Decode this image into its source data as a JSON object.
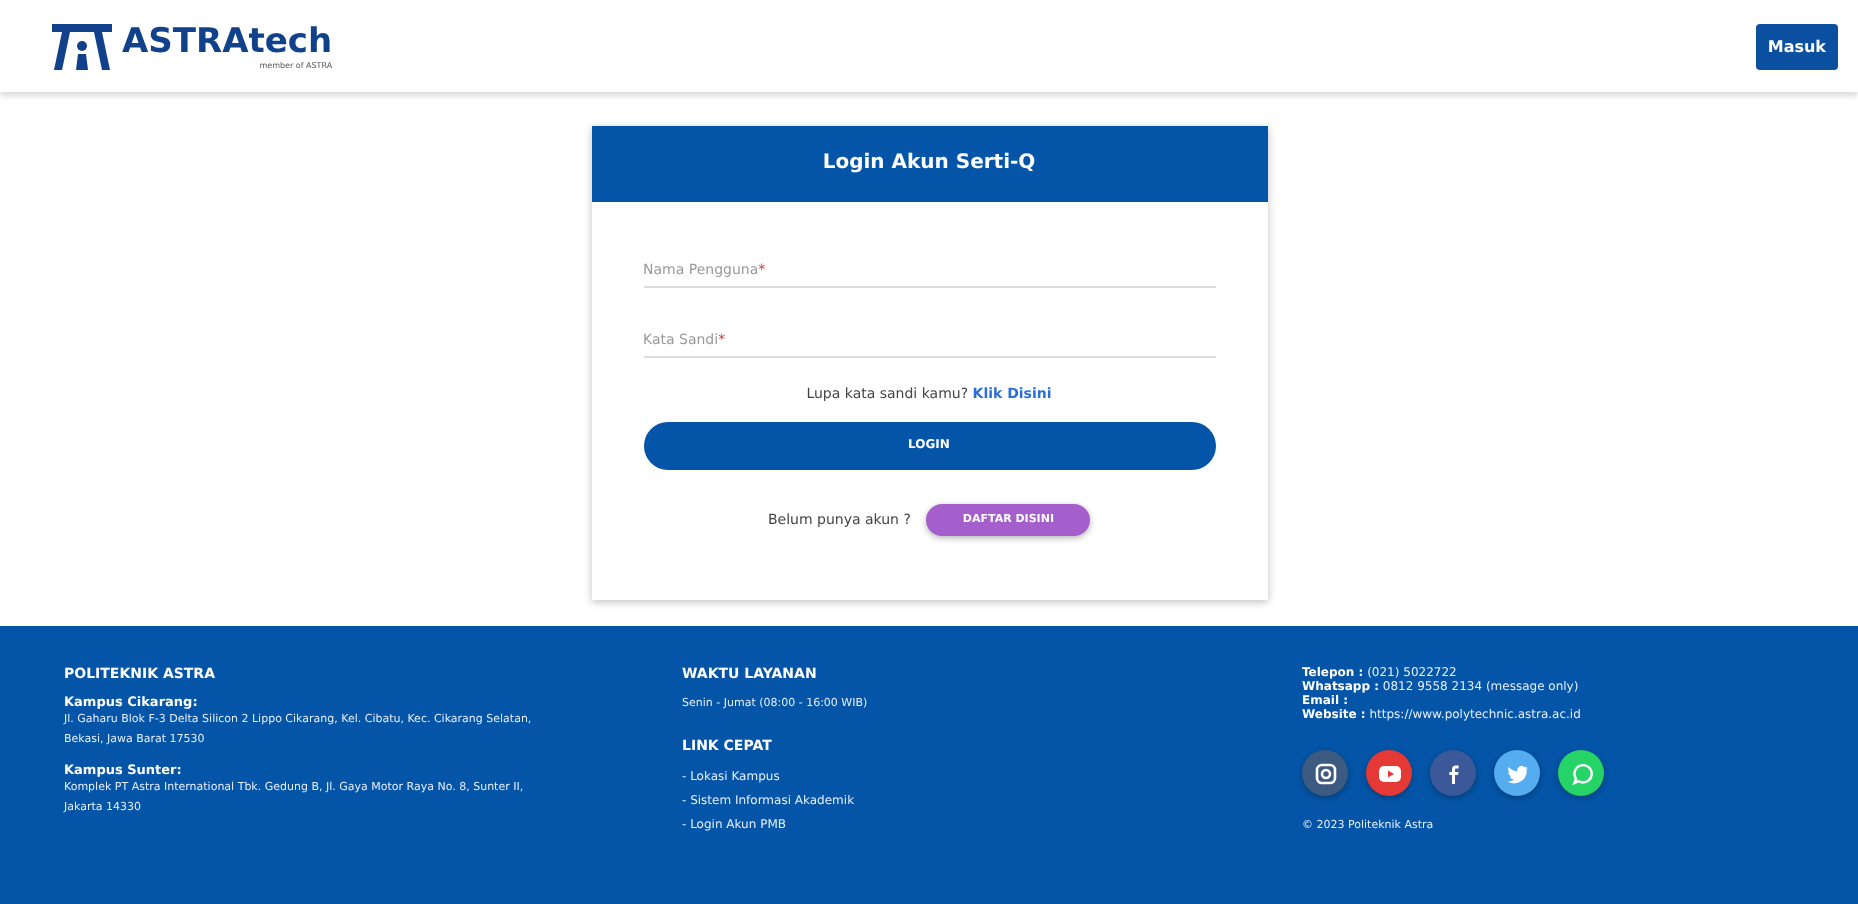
{
  "header": {
    "logo_text": "ASTRAtech",
    "logo_subtext": "member of ASTRA",
    "login_button": "Masuk"
  },
  "login_card": {
    "title": "Login Akun Serti-Q",
    "fields": [
      {
        "placeholder": "Nama Pengguna",
        "required_mark": "*"
      },
      {
        "placeholder": "Kata Sandi",
        "required_mark": "*"
      }
    ],
    "forgot_text": "Lupa kata sandi kamu?",
    "forgot_link": "Klik Disini",
    "login_button": "LOGIN",
    "register_text": "Belum punya akun ?",
    "register_button": "DAFTAR DISINI"
  },
  "footer": {
    "col1": {
      "title": "POLITEKNIK ASTRA",
      "campuses": [
        {
          "name": "Kampus Cikarang:",
          "address": "Jl. Gaharu Blok F-3 Delta Silicon 2 Lippo Cikarang, Kel. Cibatu, Kec. Cikarang Selatan, Bekasi, Jawa Barat 17530"
        },
        {
          "name": "Kampus Sunter:",
          "address": "Komplek PT Astra International Tbk. Gedung B, Jl. Gaya Motor Raya No. 8, Sunter II, Jakarta 14330"
        }
      ]
    },
    "col2": {
      "hours_title": "WAKTU LAYANAN",
      "hours": "Senin - Jumat (08:00 - 16:00 WIB)",
      "links_title": "LINK CEPAT",
      "links": [
        "- Lokasi Kampus",
        "- Sistem Informasi Akademik",
        "- Login Akun PMB"
      ]
    },
    "col3": {
      "contacts": [
        {
          "label": "Telepon :",
          "value": "(021) 5022722"
        },
        {
          "label": "Whatsapp :",
          "value": "0812 9558 2134 (message only)"
        },
        {
          "label": "Email :"
        },
        {
          "label": "Website :",
          "value": "https://www.polytechnic.astra.ac.id"
        }
      ],
      "socials": [
        {
          "kind": "instagram",
          "color": "#3d5a80"
        },
        {
          "kind": "youtube",
          "color": "#e53935"
        },
        {
          "kind": "facebook",
          "color": "#3b5998"
        },
        {
          "kind": "twitter",
          "color": "#55acee"
        },
        {
          "kind": "whatsapp",
          "color": "#25d366"
        }
      ],
      "copyright": "© 2023 Politeknik Astra"
    }
  }
}
